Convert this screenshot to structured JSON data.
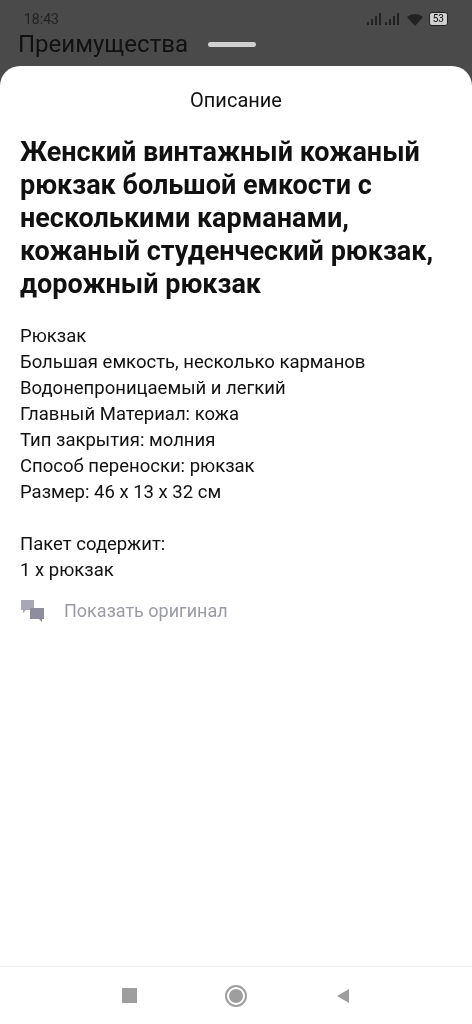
{
  "status_bar": {
    "time": "18:43",
    "battery": "53"
  },
  "background": {
    "title": "Преимущества"
  },
  "sheet": {
    "title": "Описание",
    "product_title": "Женский винтажный кожаный рюкзак большой емкости с несколькими карманами, кожаный студенческий рюкзак, дорожный рюкзак",
    "features": [
      "Рюкзак",
      "Большая емкость, несколько карманов",
      "Водонепроницаемый и легкий",
      "Главный Материал: кожа",
      "Тип закрытия: молния",
      "Способ переноски: рюкзак",
      "Размер: 46 x 13 x 32 см"
    ],
    "package": [
      "Пакет содержит:",
      "1 x рюкзак"
    ],
    "show_original": "Показать оригинал"
  }
}
